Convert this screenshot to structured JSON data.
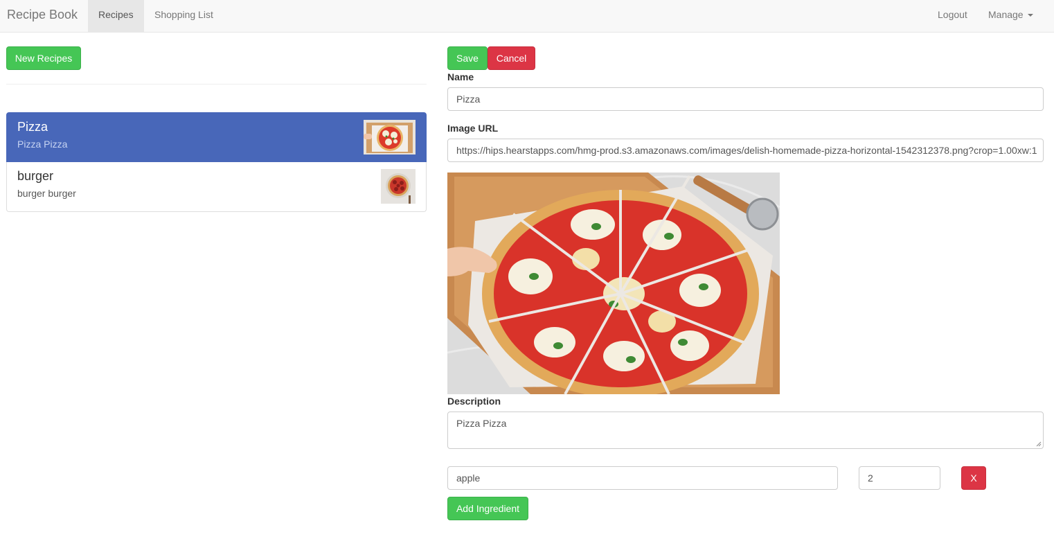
{
  "navbar": {
    "brand": "Recipe Book",
    "links": [
      {
        "label": "Recipes",
        "active": true
      },
      {
        "label": "Shopping List",
        "active": false
      }
    ],
    "right": {
      "logout": "Logout",
      "manage": "Manage"
    }
  },
  "left": {
    "new_button": "New Recipes",
    "recipes": [
      {
        "name": "Pizza",
        "description": "Pizza Pizza",
        "active": true
      },
      {
        "name": "burger",
        "description": "burger burger",
        "active": false
      }
    ]
  },
  "editor": {
    "save": "Save",
    "cancel": "Cancel",
    "name_label": "Name",
    "name_value": "Pizza",
    "image_url_label": "Image URL",
    "image_url_value": "https://hips.hearstapps.com/hmg-prod.s3.amazonaws.com/images/delish-homemade-pizza-horizontal-1542312378.png?crop=1.00xw:1",
    "description_label": "Description",
    "description_value": "Pizza Pizza",
    "ingredients": [
      {
        "name": "apple",
        "amount": "2",
        "remove": "X"
      }
    ],
    "add_ingredient": "Add Ingredient"
  },
  "colors": {
    "success": "#45c655",
    "danger": "#dc3545",
    "active_item": "#4867b9",
    "navbar_bg": "#f8f8f8"
  }
}
